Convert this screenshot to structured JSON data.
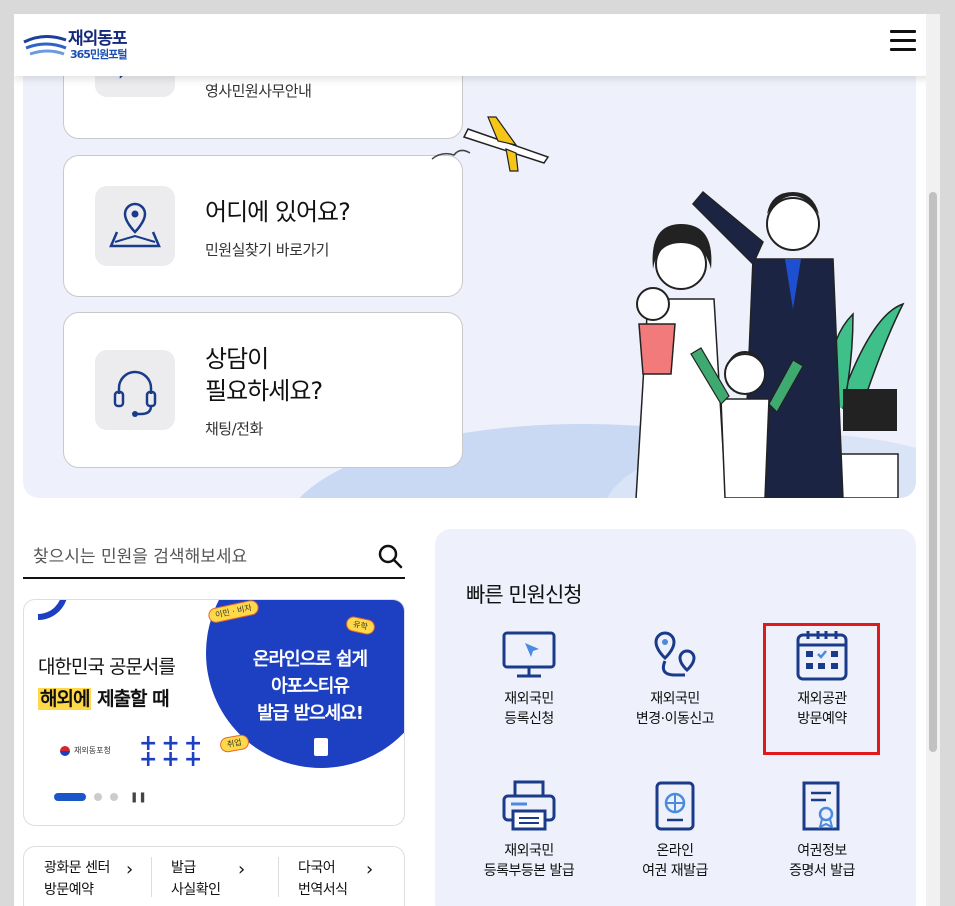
{
  "header": {
    "logo_line1": "재외동포",
    "logo_line2": "365민원포털"
  },
  "hero": {
    "cards": [
      {
        "title": "",
        "desc": "영사민원사무안내",
        "icon": "chat-bubble-icon"
      },
      {
        "title": "어디에 있어요?",
        "desc": "민원실찾기 바로가기",
        "icon": "map-pin-icon"
      },
      {
        "title_line1": "상담이",
        "title_line2": "필요하세요?",
        "desc": "채팅/전화",
        "icon": "headset-icon"
      }
    ]
  },
  "search": {
    "placeholder": "찾으시는 민원을 검색해보세요"
  },
  "banner": {
    "line1": "대한민국 공문서를",
    "line2_highlight": "해외에",
    "line2_rest": " 제출할 때",
    "org": "재외동포청",
    "circle_line1": "온라인으로 쉽게",
    "circle_line2": "아포스티유",
    "circle_line3": "발급 받으세요!",
    "tag1": "이민 · 비자",
    "tag2": "유학",
    "tag3": "취업"
  },
  "quick_links": [
    {
      "line1": "광화문 센터",
      "line2": "방문예약"
    },
    {
      "line1": "발급",
      "line2": "사실확인"
    },
    {
      "line1": "다국어",
      "line2": "번역서식"
    }
  ],
  "quick_services": {
    "title": "빠른 민원신청",
    "items": [
      {
        "line1": "재외국민",
        "line2": "등록신청",
        "icon": "monitor-icon"
      },
      {
        "line1": "재외국민",
        "line2": "변경·이동신고",
        "icon": "route-pin-icon"
      },
      {
        "line1": "재외공관",
        "line2": "방문예약",
        "icon": "calendar-icon"
      },
      {
        "line1": "재외국민",
        "line2": "등록부등본 발급",
        "icon": "printer-icon"
      },
      {
        "line1": "온라인",
        "line2": "여권 재발급",
        "icon": "passport-icon"
      },
      {
        "line1": "여권정보",
        "line2": "증명서 발급",
        "icon": "certificate-icon"
      }
    ]
  },
  "colors": {
    "brand_navy": "#14297c",
    "icon_navy": "#1a3a8a",
    "panel_bg": "#eef1fb",
    "highlight_red": "#e01a1a",
    "banner_blue": "#1d3fc1"
  }
}
